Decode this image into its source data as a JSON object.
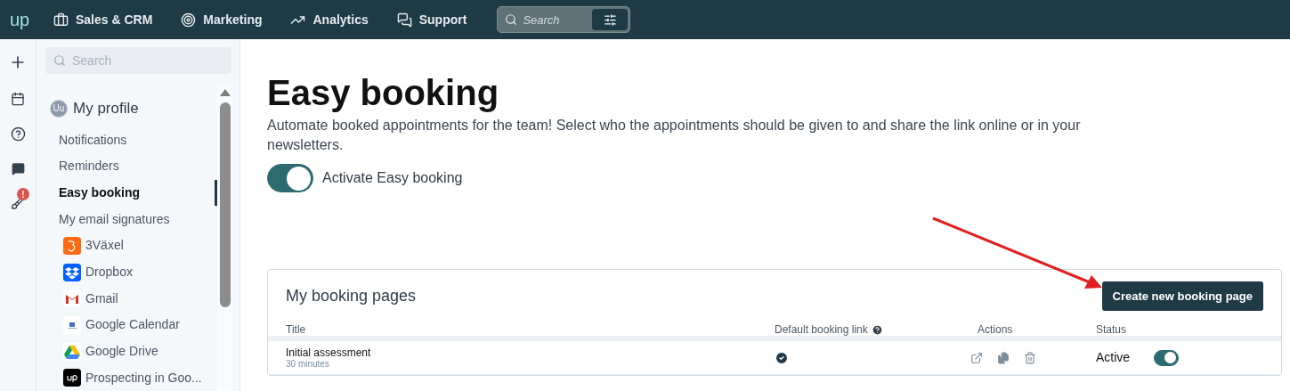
{
  "topnav": {
    "logo": "up",
    "items": [
      {
        "label": "Sales & CRM"
      },
      {
        "label": "Marketing"
      },
      {
        "label": "Analytics"
      },
      {
        "label": "Support"
      }
    ],
    "search": {
      "placeholder": "Search"
    }
  },
  "rail": {
    "badge": "!"
  },
  "sidebar": {
    "search": {
      "placeholder": "Search"
    },
    "avatar": "Uu",
    "profile": "My profile",
    "items": [
      {
        "label": "Notifications",
        "kind": "link",
        "selected": false
      },
      {
        "label": "Reminders",
        "kind": "link",
        "selected": false
      },
      {
        "label": "Easy booking",
        "kind": "link",
        "selected": true
      },
      {
        "label": "My email signatures",
        "kind": "link",
        "selected": false
      },
      {
        "label": "3Växel",
        "kind": "integration",
        "selected": false
      },
      {
        "label": "Dropbox",
        "kind": "integration",
        "selected": false
      },
      {
        "label": "Gmail",
        "kind": "integration",
        "selected": false
      },
      {
        "label": "Google Calendar",
        "kind": "integration",
        "selected": false
      },
      {
        "label": "Google Drive",
        "kind": "integration",
        "selected": false
      },
      {
        "label": "Prospecting in Goo...",
        "kind": "integration",
        "selected": false
      }
    ]
  },
  "main": {
    "title": "Easy booking",
    "description": "Automate booked appointments for the team! Select who the appointments should be given to and share the link online or in your newsletters.",
    "activate": {
      "label": "Activate Easy booking",
      "on": true
    },
    "card": {
      "title": "My booking pages",
      "button": "Create new booking page",
      "columns": [
        "Title",
        "Default booking link",
        "Actions",
        "Status"
      ],
      "rows": [
        {
          "title": "Initial assessment",
          "duration": "30 minutes",
          "default": true,
          "status": "Active",
          "on": true
        }
      ]
    }
  }
}
